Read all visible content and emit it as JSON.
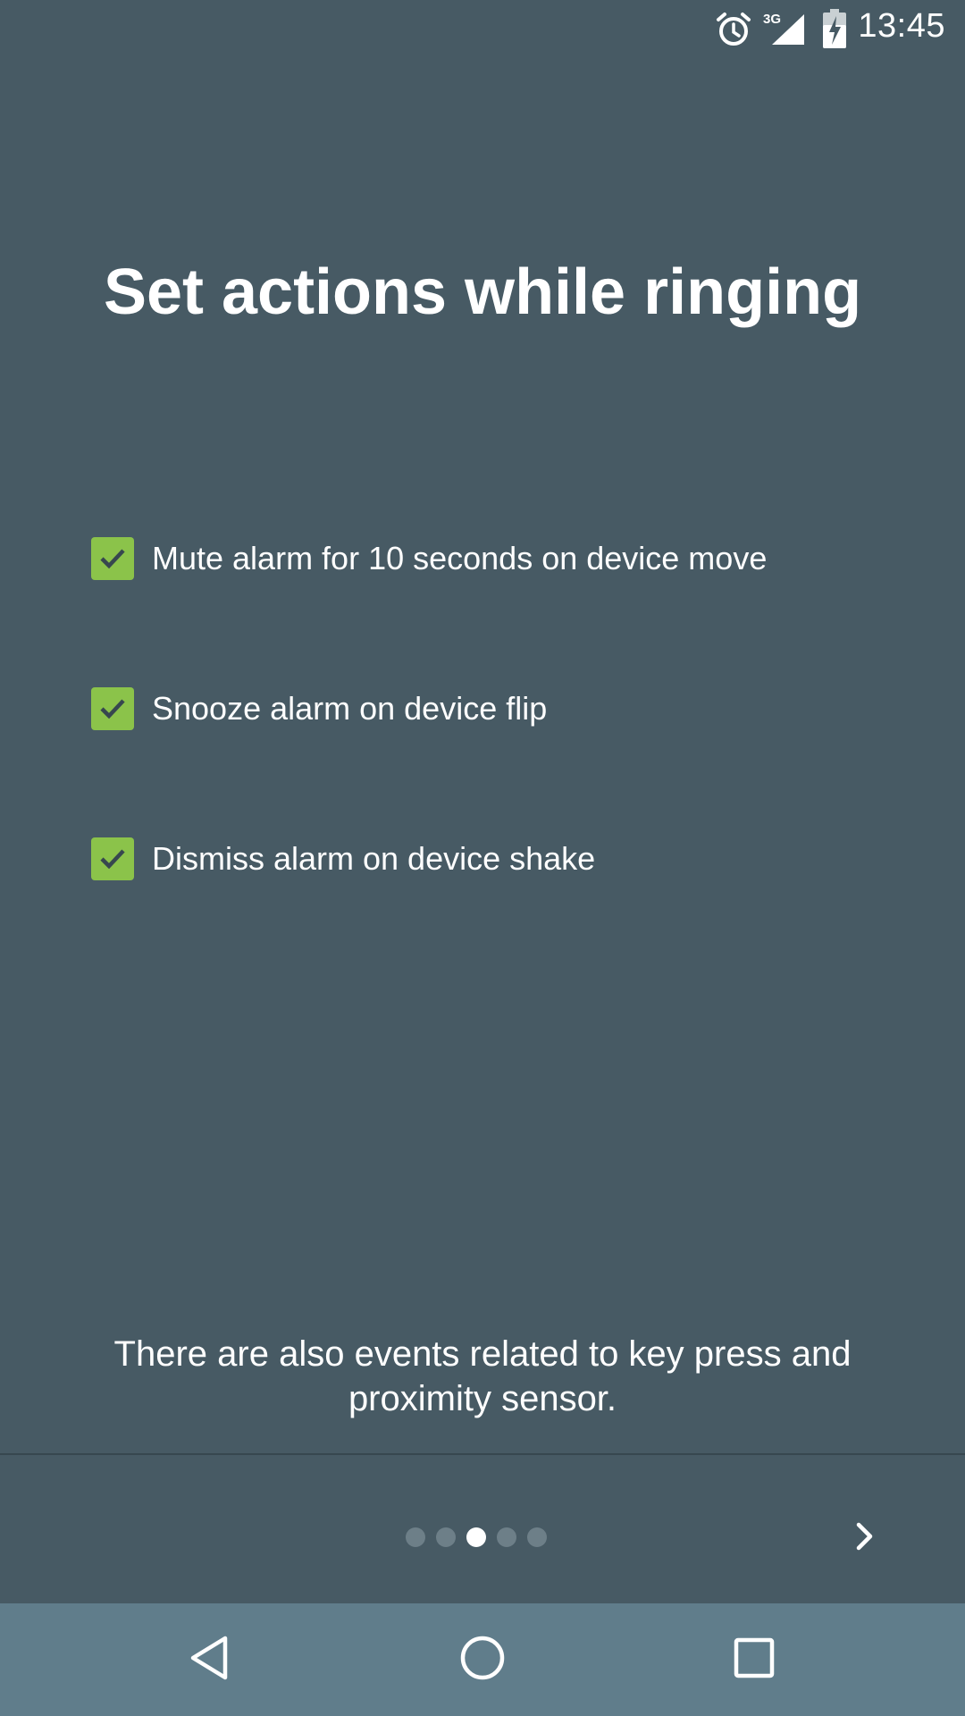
{
  "status_bar": {
    "time": "13:45",
    "network_label": "3G",
    "icons": [
      "alarm-icon",
      "signal-icon",
      "battery-icon"
    ]
  },
  "title": "Set actions while ringing",
  "options": [
    {
      "label": "Mute alarm for 10 seconds on device move",
      "checked": true
    },
    {
      "label": "Snooze alarm on device flip",
      "checked": true
    },
    {
      "label": "Dismiss alarm on device shake",
      "checked": true
    }
  ],
  "footer_message": "There are also events related to key press and proximity sensor.",
  "pager": {
    "total_pages": 5,
    "current_page": 3,
    "next_icon": "chevron-right-icon"
  },
  "nav_bar": {
    "icons": [
      "back-icon",
      "home-icon",
      "recents-icon"
    ]
  },
  "colors": {
    "background": "#475a64",
    "checkbox": "#8bc34a",
    "nav_bar": "#607d8b",
    "dot_inactive": "#6d7f88",
    "dot_active": "#ffffff"
  }
}
